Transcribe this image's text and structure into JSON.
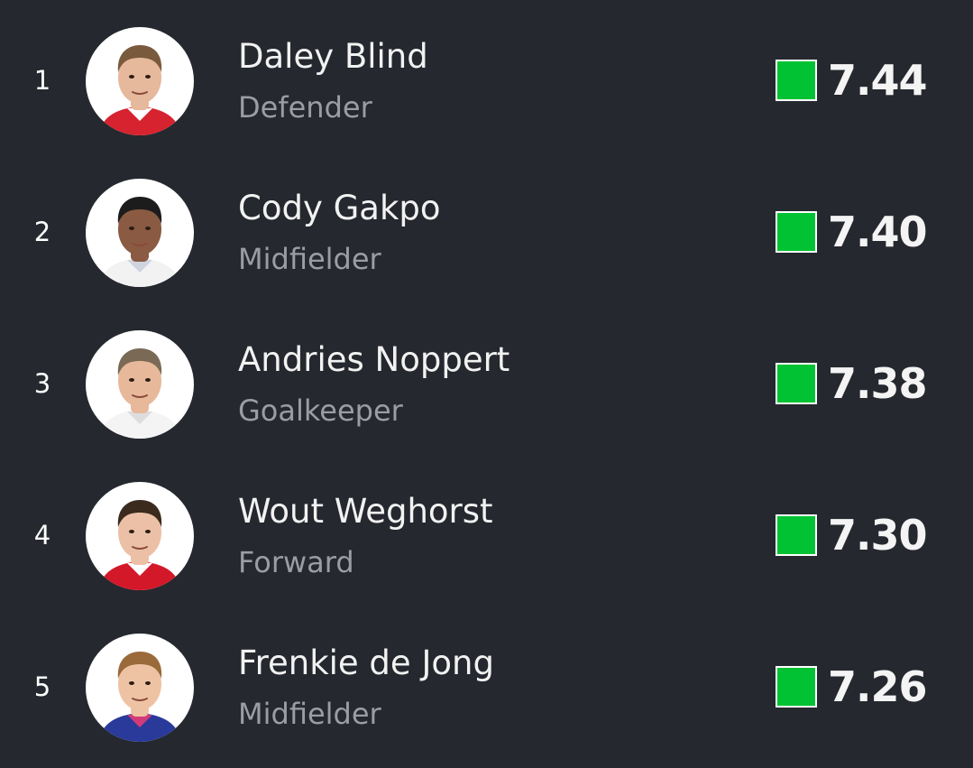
{
  "players": [
    {
      "rank": "1",
      "name": "Daley Blind",
      "position": "Defender",
      "rating": "7.44",
      "rating_color": "#00c232",
      "avatar": {
        "skin": "#e6b89c",
        "hair": "#7a5a3c",
        "shirt": "#d6232f",
        "shirt2": "#ffffff"
      }
    },
    {
      "rank": "2",
      "name": "Cody Gakpo",
      "position": "Midfielder",
      "rating": "7.40",
      "rating_color": "#00c232",
      "avatar": {
        "skin": "#8a5a42",
        "hair": "#1c1c1c",
        "shirt": "#f2f2f2",
        "shirt2": "#d0d4e0"
      }
    },
    {
      "rank": "3",
      "name": "Andries Noppert",
      "position": "Goalkeeper",
      "rating": "7.38",
      "rating_color": "#00c232",
      "avatar": {
        "skin": "#e8b89a",
        "hair": "#7a6a55",
        "shirt": "#f4f4f4",
        "shirt2": "#dddddd"
      }
    },
    {
      "rank": "4",
      "name": "Wout Weghorst",
      "position": "Forward",
      "rating": "7.30",
      "rating_color": "#00c232",
      "avatar": {
        "skin": "#ecc0a6",
        "hair": "#3b2a1e",
        "shirt": "#d3182a",
        "shirt2": "#ffffff"
      }
    },
    {
      "rank": "5",
      "name": "Frenkie de Jong",
      "position": "Midfielder",
      "rating": "7.26",
      "rating_color": "#00c232",
      "avatar": {
        "skin": "#eec3a4",
        "hair": "#9a6a3a",
        "shirt": "#2a3a9a",
        "shirt2": "#d23a7a"
      }
    }
  ]
}
